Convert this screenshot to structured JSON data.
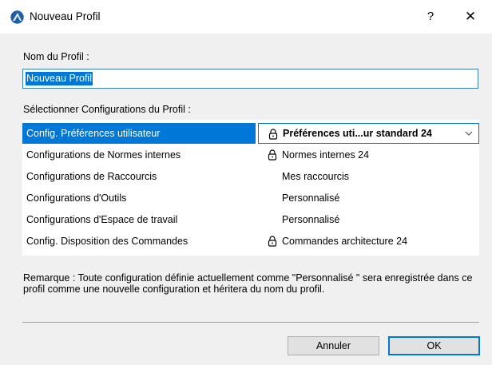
{
  "window": {
    "title": "Nouveau Profil",
    "help_label": "?",
    "close_label": "✕"
  },
  "profile_name": {
    "label": "Nom du Profil :",
    "value": "Nouveau Profil"
  },
  "configs": {
    "label": "Sélectionner Configurations du Profil :",
    "rows": [
      {
        "name": "Config. Préférences utilisateur",
        "value": "Préférences uti...ur standard 24",
        "locked": true,
        "selected": true
      },
      {
        "name": "Configurations de Normes  internes",
        "value": "Normes internes 24",
        "locked": true
      },
      {
        "name": "Configurations de Raccourcis",
        "value": "Mes raccourcis",
        "locked": false
      },
      {
        "name": "Configurations d'Outils",
        "value": "Personnalisé",
        "locked": false
      },
      {
        "name": "Configurations d'Espace de travail",
        "value": "Personnalisé",
        "locked": false
      },
      {
        "name": "Config. Disposition des Commandes",
        "value": "Commandes architecture 24",
        "locked": true
      }
    ]
  },
  "remark": "Remarque : Toute configuration définie actuellement comme \"Personnalisé \" sera enregistrée dans ce profil comme une nouvelle configuration et héritera du nom du profil.",
  "buttons": {
    "cancel": "Annuler",
    "ok": "OK"
  },
  "colors": {
    "selection": "#0078d7",
    "dialog_bg": "#f0f0f0",
    "app_icon": "#2a6fb8"
  }
}
